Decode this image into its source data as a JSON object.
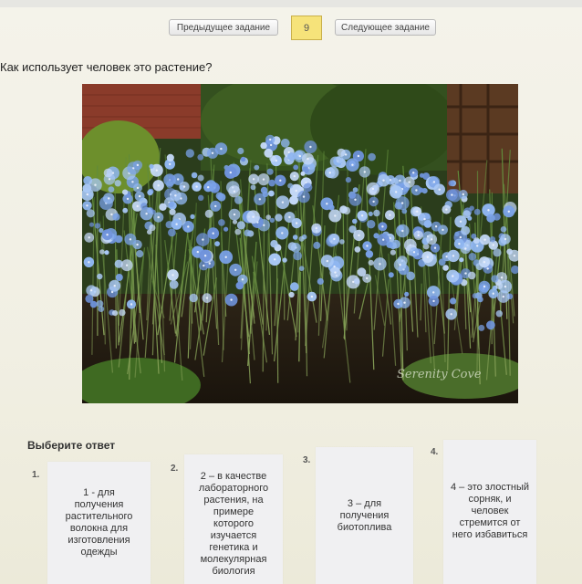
{
  "nav": {
    "prev_label": "Предыдущее задание",
    "task_number": "9",
    "next_label": "Следующее задание"
  },
  "question": "Как использует человек это растение?",
  "photo": {
    "watermark": "Serenity Cove"
  },
  "answers": {
    "title": "Выберите ответ",
    "options": [
      {
        "number": "1.",
        "text": "1 - для\nполучения\nрастительного\nволокна для\nизготовления\nодежды"
      },
      {
        "number": "2.",
        "text": "2 – в качестве\nлабораторного\nрастения, на\nпримере\nкоторого\nизучается\nгенетика и\nмолекулярная\nбиология"
      },
      {
        "number": "3.",
        "text": "3 – для\nполучения\nбиотоплива"
      },
      {
        "number": "4.",
        "text": "4 – это злостный\nсорняк, и\nчеловек\nстремится от\nнего избавиться"
      }
    ]
  },
  "colors": {
    "task_number_bg": "#f6e37a",
    "flower": "#8fb6f0"
  }
}
